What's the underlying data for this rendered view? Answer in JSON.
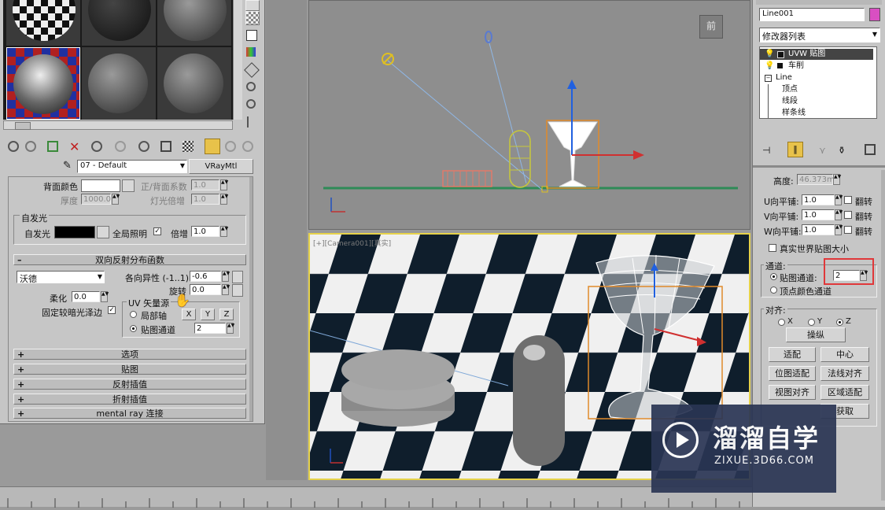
{
  "material_editor": {
    "material_name": "07 - Default",
    "material_type": "VRayMtl",
    "back_color_label": "背面颜色",
    "front_back_coeff_label": "正/背面系数",
    "front_back_coeff_value": "1.0",
    "thickness_label": "厚度",
    "thickness_value": "1000.0",
    "light_multiplier_label": "灯光倍增",
    "light_multiplier_value": "1.0",
    "self_illum_group": "自发光",
    "self_illum_label": "自发光",
    "gi_label": "全局照明",
    "multiplier_label": "倍增",
    "multiplier_value": "1.0",
    "brdf_rollout": "双向反射分布函数",
    "brdf_type": "沃德",
    "anisotropy_label": "各向异性 (-1..1)",
    "anisotropy_value": "-0.6",
    "rotation_label": "旋转",
    "rotation_value": "0.0",
    "soften_label": "柔化",
    "soften_value": "0.0",
    "fix_dark_edges_label": "固定较暗光泽边",
    "uv_source_group": "UV 矢量源",
    "local_axis_label": "局部轴",
    "axis_x": "X",
    "axis_y": "Y",
    "axis_z": "Z",
    "map_channel_label": "贴图通道",
    "map_channel_value": "2",
    "rollouts": [
      "选项",
      "贴图",
      "反射插值",
      "折射插值",
      "mental ray 连接"
    ]
  },
  "viewports": {
    "top_label": "前",
    "bottom_label": "[+][Camera001][真实]"
  },
  "command_panel": {
    "object_name": "Line001",
    "object_color": "#d94fc2",
    "modifier_list_label": "修改器列表",
    "stack": [
      {
        "label": "UVW 贴图",
        "selected": true
      },
      {
        "label": "车削",
        "selected": false
      },
      {
        "label": "Line",
        "selected": false
      },
      {
        "label": "顶点",
        "selected": false
      },
      {
        "label": "线段",
        "selected": false
      },
      {
        "label": "样条线",
        "selected": false
      }
    ],
    "height_label": "高度:",
    "height_value": "46.373m",
    "u_tile_label": "U向平铺:",
    "u_tile_value": "1.0",
    "v_tile_label": "V向平铺:",
    "v_tile_value": "1.0",
    "w_tile_label": "W向平铺:",
    "w_tile_value": "1.0",
    "flip_label": "翻转",
    "real_world_label": "真实世界贴图大小",
    "channel_group": "通道:",
    "map_channel_label": "贴图通道:",
    "map_channel_value": "2",
    "vertex_color_label": "顶点颜色通道",
    "align_group": "对齐:",
    "align_x": "X",
    "align_y": "Y",
    "align_z": "Z",
    "manipulate_btn": "操纵",
    "fit_btn": "适配",
    "center_btn": "中心",
    "bitmap_fit_btn": "位图适配",
    "normal_align_btn": "法线对齐",
    "view_align_btn": "视图对齐",
    "region_fit_btn": "区域适配",
    "acquire_btn": "获取"
  },
  "watermark": {
    "title": "溜溜自学",
    "url": "ZIXUE.3D66.COM"
  }
}
